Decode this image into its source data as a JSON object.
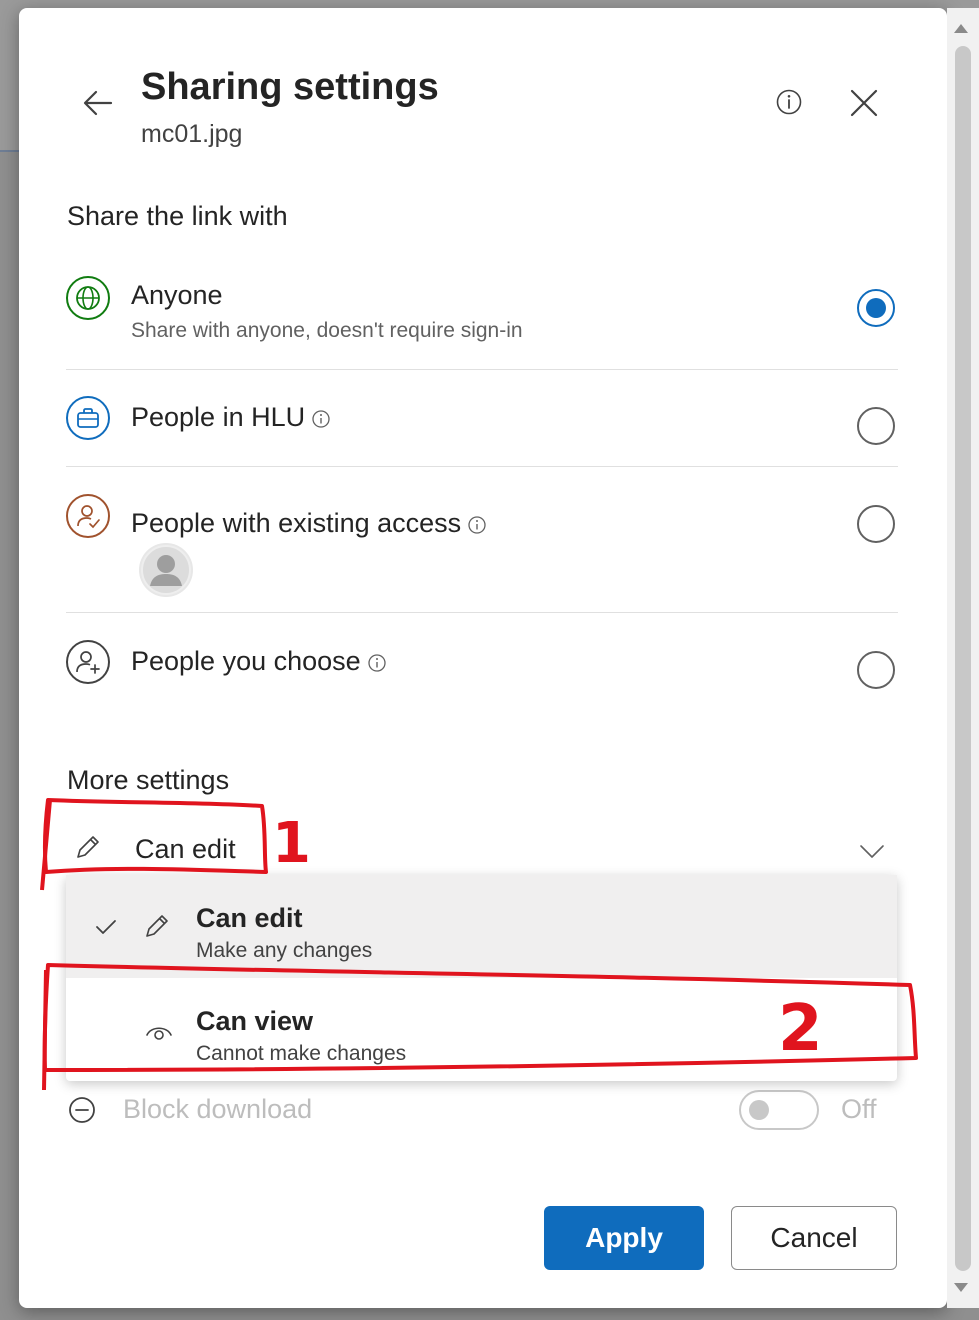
{
  "dialog": {
    "title": "Sharing settings",
    "file_name": "mc01.jpg"
  },
  "share": {
    "heading": "Share the link with",
    "options": [
      {
        "label": "Anyone",
        "description": "Share with anyone, doesn't require sign-in",
        "selected": true,
        "icon": "globe-icon",
        "icon_color": "#107c10"
      },
      {
        "label": "People in HLU",
        "selected": false,
        "icon": "briefcase-icon",
        "icon_color": "#0f6cbd"
      },
      {
        "label": "People with existing access",
        "selected": false,
        "icon": "person-check-icon",
        "icon_color": "#a0522d"
      },
      {
        "label": "People you choose",
        "selected": false,
        "icon": "person-add-icon",
        "icon_color": "#424242"
      }
    ]
  },
  "more": {
    "heading": "More settings",
    "permission_label": "Can edit",
    "menu": [
      {
        "title": "Can edit",
        "description": "Make any changes",
        "selected": true
      },
      {
        "title": "Can view",
        "description": "Cannot make changes",
        "selected": false
      }
    ],
    "block_download": {
      "label": "Block download",
      "state": "Off"
    }
  },
  "buttons": {
    "apply": "Apply",
    "cancel": "Cancel"
  },
  "annotations": {
    "mark1": "1",
    "mark2": "2",
    "color": "#e0141e"
  },
  "colors": {
    "accent": "#0f6cbd"
  }
}
